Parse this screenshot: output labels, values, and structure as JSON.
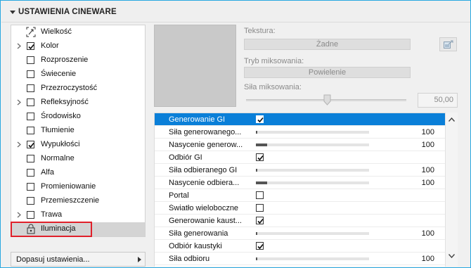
{
  "panel": {
    "title": "USTAWIENIA CINEWARE"
  },
  "tree": {
    "items": [
      {
        "label": "Wielkość",
        "kind": "icon",
        "icon": "resize-icon",
        "expandable": false,
        "checked": false,
        "selected": false
      },
      {
        "label": "Kolor",
        "kind": "checkbox",
        "expandable": true,
        "checked": true,
        "selected": false
      },
      {
        "label": "Rozproszenie",
        "kind": "checkbox",
        "expandable": false,
        "checked": false,
        "selected": false
      },
      {
        "label": "Świecenie",
        "kind": "checkbox",
        "expandable": false,
        "checked": false,
        "selected": false
      },
      {
        "label": "Przezroczystość",
        "kind": "checkbox",
        "expandable": false,
        "checked": false,
        "selected": false
      },
      {
        "label": "Refleksyjność",
        "kind": "checkbox",
        "expandable": true,
        "checked": false,
        "selected": false
      },
      {
        "label": "Środowisko",
        "kind": "checkbox",
        "expandable": false,
        "checked": false,
        "selected": false
      },
      {
        "label": "Tłumienie",
        "kind": "checkbox",
        "expandable": false,
        "checked": false,
        "selected": false
      },
      {
        "label": "Wypukłości",
        "kind": "checkbox",
        "expandable": true,
        "checked": true,
        "selected": false
      },
      {
        "label": "Normalne",
        "kind": "checkbox",
        "expandable": false,
        "checked": false,
        "selected": false
      },
      {
        "label": "Alfa",
        "kind": "checkbox",
        "expandable": false,
        "checked": false,
        "selected": false
      },
      {
        "label": "Promieniowanie",
        "kind": "checkbox",
        "expandable": false,
        "checked": false,
        "selected": false
      },
      {
        "label": "Przemieszczenie",
        "kind": "checkbox",
        "expandable": false,
        "checked": false,
        "selected": false
      },
      {
        "label": "Trawa",
        "kind": "checkbox",
        "expandable": true,
        "checked": false,
        "selected": false
      },
      {
        "label": "Iluminacja",
        "kind": "icon",
        "icon": "lock-icon",
        "expandable": false,
        "checked": false,
        "selected": true
      }
    ]
  },
  "adjust_button": {
    "label": "Dopasuj ustawienia..."
  },
  "texture": {
    "label": "Tekstura:",
    "value": "Żadne",
    "blend_mode_label": "Tryb miksowania:",
    "blend_mode_value": "Powielenie",
    "blend_strength_label": "Siła miksowania:",
    "blend_strength_value": "50,00",
    "blend_strength_fraction": 0.5
  },
  "gi_table": {
    "rows": [
      {
        "name": "Generowanie GI",
        "type": "checkbox",
        "checked": true,
        "selected": true
      },
      {
        "name": "Siła generowanego...",
        "type": "slider",
        "value": "100",
        "fraction": 0.0
      },
      {
        "name": "Nasycenie generow...",
        "type": "slider",
        "value": "100",
        "fraction": 0.1
      },
      {
        "name": "Odbiór GI",
        "type": "checkbox",
        "checked": true
      },
      {
        "name": "Siła odbieranego GI",
        "type": "slider",
        "value": "100",
        "fraction": 0.0
      },
      {
        "name": "Nasycenie odbiera...",
        "type": "slider",
        "value": "100",
        "fraction": 0.1
      },
      {
        "name": "Portal",
        "type": "checkbox",
        "checked": false
      },
      {
        "name": "Światło wieloboczne",
        "type": "checkbox",
        "checked": false
      },
      {
        "name": "Generowanie kaust...",
        "type": "checkbox",
        "checked": true
      },
      {
        "name": "Siła generowania",
        "type": "slider",
        "value": "100",
        "fraction": 0.0
      },
      {
        "name": "Odbiór kaustyki",
        "type": "checkbox",
        "checked": true
      },
      {
        "name": "Siła odbioru",
        "type": "slider",
        "value": "100",
        "fraction": 0.0
      }
    ]
  },
  "colors": {
    "selection": "#0a7fd8",
    "highlight_box": "#e0202a",
    "frame": "#29a8e0"
  }
}
